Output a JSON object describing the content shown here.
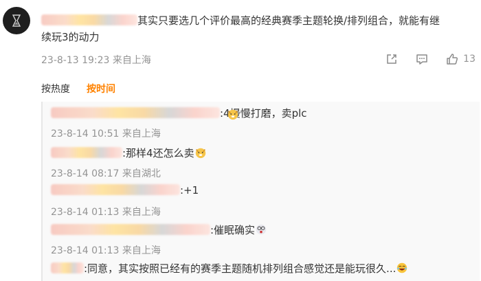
{
  "comment": {
    "text_line1": "其实只要选几个评价最高的经典赛季主题轮换/排列组合，就能有继",
    "text_line2": "续玩3的动力",
    "time": "23-8-13 19:23",
    "location": "来自上海",
    "like_count": "13",
    "icons": [
      "share-icon",
      "comment-icon",
      "like-icon"
    ]
  },
  "sort": {
    "hot_label": "按热度",
    "time_label": "按时间",
    "active": "time",
    "active_color": "#ff8200"
  },
  "replies": [
    {
      "text": ":4慢慢打磨，卖plc",
      "time": "23-8-14 10:51",
      "location": "来自上海",
      "emoji": "dog-emoji"
    },
    {
      "text": ":那样4还怎么卖",
      "time": "23-8-14 08:17",
      "location": "来自湖北",
      "emoji": "dog-emoji"
    },
    {
      "text": ":+1",
      "time": "23-8-14 01:13",
      "location": "来自上海"
    },
    {
      "text": ":催眠确实",
      "time": "23-8-14 01:13",
      "location": "来自上海",
      "emoji": "dizzy-emoji"
    },
    {
      "text": ":同意，其实按照已经有的赛季主题随机排列组合感觉还是能玩很久...",
      "emoji": "laugh-emoji"
    }
  ]
}
